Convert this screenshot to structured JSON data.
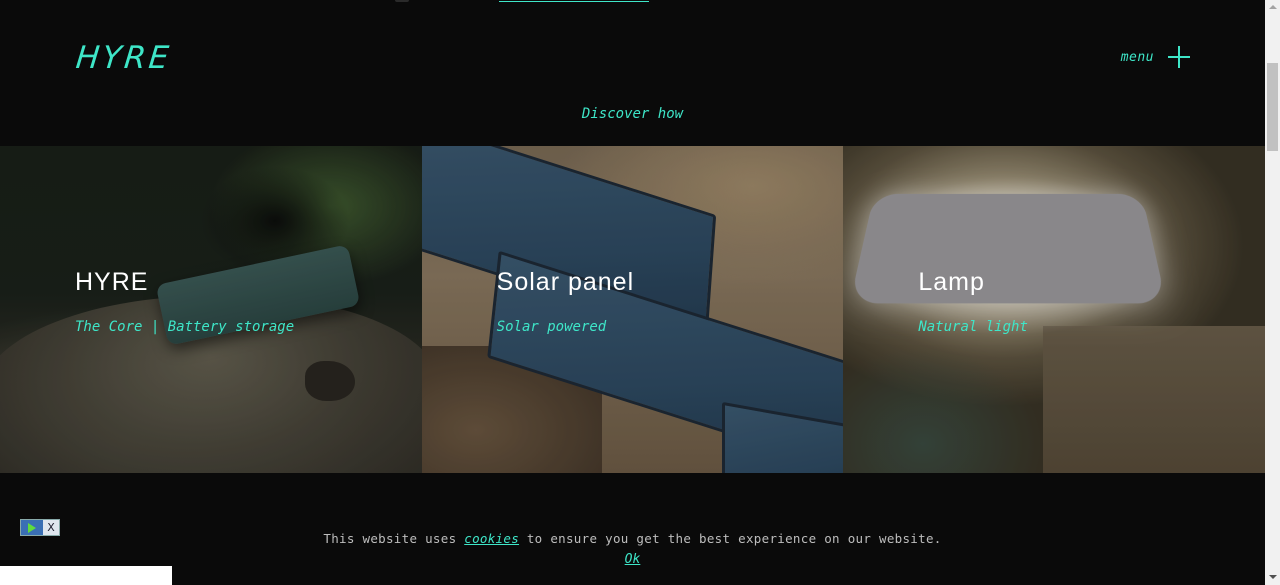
{
  "header": {
    "logo": "HYRE",
    "menu_label": "menu",
    "menu_icon": "plus-icon"
  },
  "discover_link": "Discover how",
  "cards": [
    {
      "title": "HYRE",
      "subtitle": "The Core | Battery storage"
    },
    {
      "title": "Solar panel",
      "subtitle": "Solar powered"
    },
    {
      "title": "Lamp",
      "subtitle": "Natural light"
    }
  ],
  "cookie": {
    "text_before": "This website uses ",
    "link": "cookies",
    "text_after": " to ensure you get the best experience on our website.",
    "ok_label": "Ok"
  },
  "ad_widget": {
    "play_icon": "play-icon",
    "close_label": "X"
  },
  "colors": {
    "accent": "#3ee6c8",
    "background": "#0a0a0a"
  }
}
